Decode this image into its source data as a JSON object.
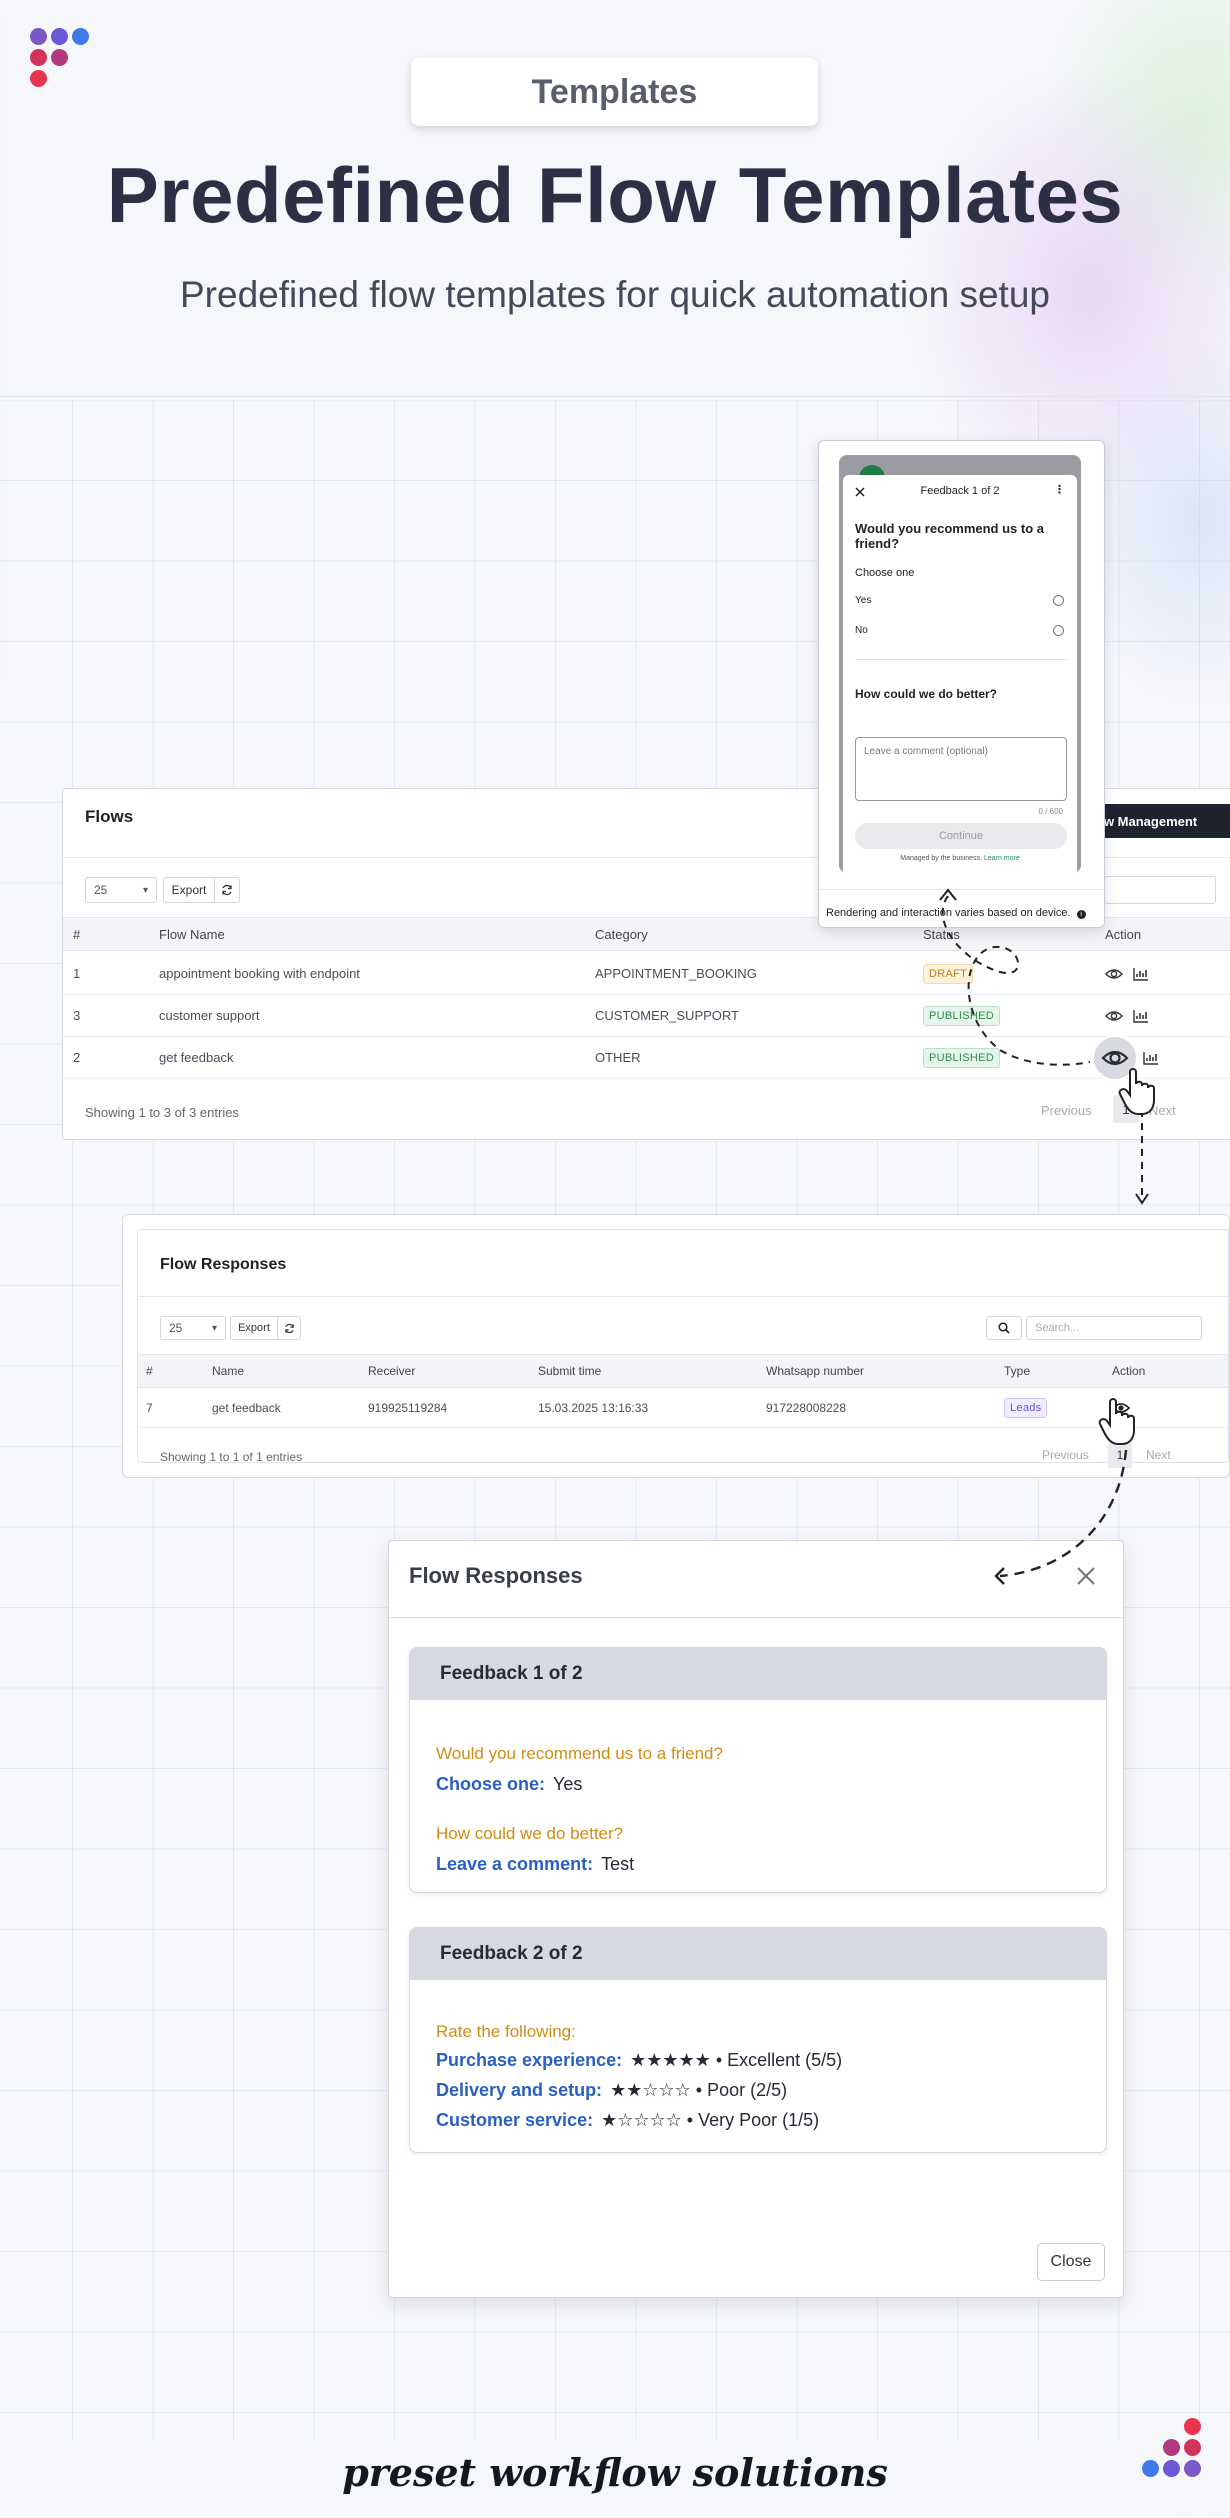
{
  "header": {
    "badge": "Templates",
    "title": "Predefined Flow Templates",
    "subtitle": "Predefined flow templates for quick automation setup"
  },
  "colors": {
    "brand_purple": "#7b57c7",
    "brand_blue": "#3f7be8",
    "brand_magenta": "#b2397e",
    "brand_red": "#e8344f",
    "draft": "#b7812c",
    "published": "#2f8a4c",
    "question": "#cf8c17",
    "answer_label": "#2a5fc4"
  },
  "flows": {
    "title": "Flows",
    "manage_button": "ow Management",
    "page_size": "25",
    "export": "Export",
    "columns": [
      "#",
      "Flow Name",
      "Category",
      "Status",
      "Action"
    ],
    "rows": [
      {
        "id": "1",
        "name": "appointment booking with endpoint",
        "category": "APPOINTMENT_BOOKING",
        "status": "DRAFT"
      },
      {
        "id": "3",
        "name": "customer support",
        "category": "CUSTOMER_SUPPORT",
        "status": "PUBLISHED"
      },
      {
        "id": "2",
        "name": "get feedback",
        "category": "OTHER",
        "status": "PUBLISHED"
      }
    ],
    "footer": "Showing 1 to 3 of 3 entries",
    "prev": "Previous",
    "page": "1",
    "next": "Next",
    "action_icons": [
      "eye-icon",
      "bar-chart-icon"
    ]
  },
  "phone_preview": {
    "header": "Feedback 1 of 2",
    "question1": "Would you recommend us to a friend?",
    "choose_one": "Choose one",
    "option_yes": "Yes",
    "option_no": "No",
    "question2": "How could we do better?",
    "comment_placeholder": "Leave a comment (optional)",
    "counter": "0 / 600",
    "continue": "Continue",
    "managed_by": "Managed by the business.",
    "learn_more": "Learn more",
    "device_note": "Rendering and interaction varies based on device."
  },
  "responses": {
    "title": "Flow Responses",
    "page_size": "25",
    "export": "Export",
    "search_placeholder": "Search...",
    "columns": [
      "#",
      "Name",
      "Receiver",
      "Submit time",
      "Whatsapp number",
      "Type",
      "Action"
    ],
    "rows": [
      {
        "id": "7",
        "name": "get feedback",
        "receiver": "919925119284",
        "submit_time": "15.03.2025 13:16:33",
        "whatsapp": "917228008228",
        "type": "Leads"
      }
    ],
    "footer": "Showing 1 to 1 of 1 entries",
    "prev": "Previous",
    "page": "1",
    "next": "Next"
  },
  "modal": {
    "title": "Flow Responses",
    "card1": {
      "header": "Feedback 1 of 2",
      "q1": "Would you recommend us to a friend?",
      "a1_label": "Choose one:",
      "a1_value": "Yes",
      "q2": "How could we do better?",
      "a2_label": "Leave a comment:",
      "a2_value": "Test"
    },
    "card2": {
      "header": "Feedback 2 of 2",
      "q": "Rate the following:",
      "ratings": [
        {
          "label": "Purchase experience:",
          "stars": "★★★★★",
          "text": "• Excellent (5/5)",
          "value": 5
        },
        {
          "label": "Delivery and setup:",
          "stars": "★★☆☆☆",
          "text": "• Poor (2/5)",
          "value": 2
        },
        {
          "label": "Customer service:",
          "stars": "★☆☆☆☆",
          "text": "• Very Poor (1/5)",
          "value": 1
        }
      ]
    },
    "close": "Close"
  },
  "tagline": "preset workflow solutions"
}
